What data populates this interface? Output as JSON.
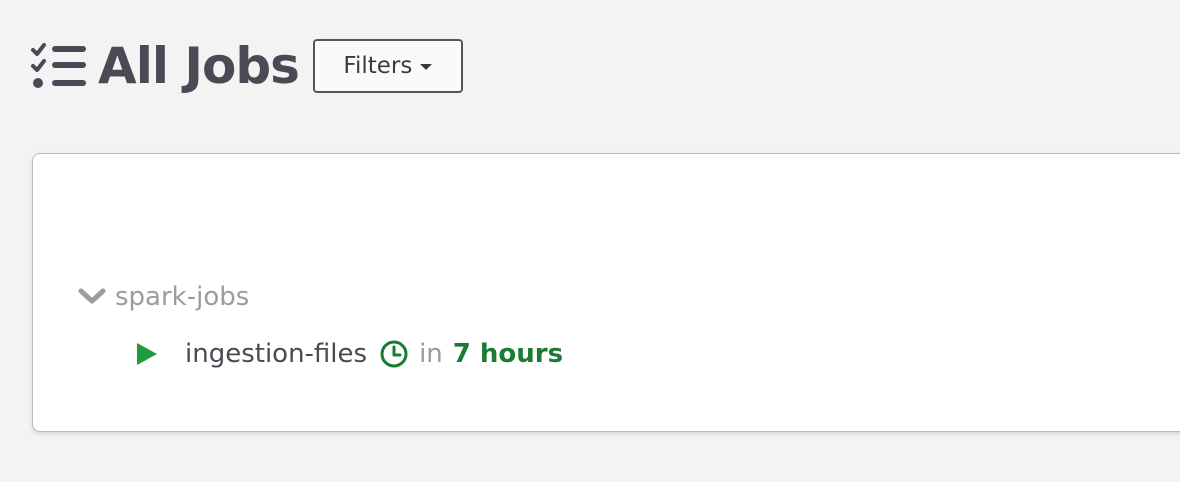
{
  "header": {
    "title": "All Jobs",
    "title_icon": "tasks-list-icon",
    "filters_label": "Filters",
    "filters_icon": "caret-down-icon"
  },
  "groups": [
    {
      "name": "spark-jobs",
      "expanded": true,
      "icon": "chevron-down-icon",
      "jobs": [
        {
          "name": "ingestion-files",
          "run_icon": "play-icon",
          "schedule_icon": "clock-icon",
          "next_run_prefix": "in",
          "next_run_time": "7 hours"
        }
      ]
    }
  ],
  "colors": {
    "background": "#f3f3f3",
    "card": "#ffffff",
    "text_primary": "#4a4a55",
    "text_muted": "#9b9ba2",
    "accent_green": "#1b7a34",
    "play_green": "#1f9a3f"
  }
}
